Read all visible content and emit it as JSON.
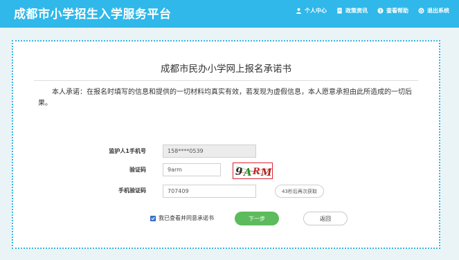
{
  "header": {
    "brand": "成都市小学招生入学服务平台",
    "nav": [
      {
        "icon": "user-icon",
        "label": "个人中心"
      },
      {
        "icon": "document-icon",
        "label": "政策资讯"
      },
      {
        "icon": "help-icon",
        "label": "查看帮助"
      },
      {
        "icon": "power-icon",
        "label": "退出系统"
      }
    ],
    "accent_color": "#2fb8e9"
  },
  "card": {
    "title": "成都市民办小学网上报名承诺书",
    "promise": "本人承诺：在报名时填写的信息和提供的一切材料均真实有效，若发现为虚假信息，本人愿意承担由此所造成的一切后果。"
  },
  "form": {
    "phone": {
      "label": "监护人1手机号",
      "value": "158****0539"
    },
    "captcha": {
      "label": "验证码",
      "value": "9arm",
      "image_text": "9ARM"
    },
    "sms": {
      "label": "手机验证码",
      "value": "707409",
      "button": "43秒后再次获取"
    },
    "agree_label": "我已查看并同意承诺书",
    "next_label": "下一步",
    "back_label": "返回"
  }
}
